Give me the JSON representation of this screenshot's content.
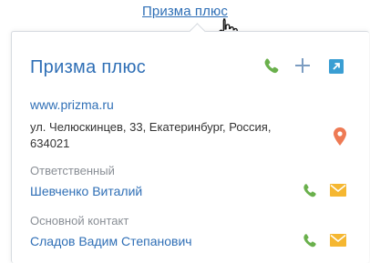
{
  "top_link": {
    "text": "Призма плюс"
  },
  "card": {
    "title": "Призма плюс",
    "website": "www.prizma.ru",
    "address": "ул. Челюскинцев, 33, Екатеринбург, Россия, 634021",
    "responsible": {
      "label": "Ответственный",
      "name": "Шевченко Виталий"
    },
    "main_contact": {
      "label": "Основной контакт",
      "name": "Сладов Вадим Степанович"
    },
    "actions": {
      "call_icon": "phone-icon",
      "add_icon": "plus-icon",
      "open_icon": "open-external-icon",
      "map_icon": "map-pin-icon",
      "email_icon": "envelope-icon"
    }
  },
  "colors": {
    "link": "#2f6fb6",
    "phone": "#6ab04c",
    "mail": "#f5b731",
    "pin": "#ee7a54",
    "plus": "#7b9cc1",
    "open": "#3a9ed3"
  }
}
